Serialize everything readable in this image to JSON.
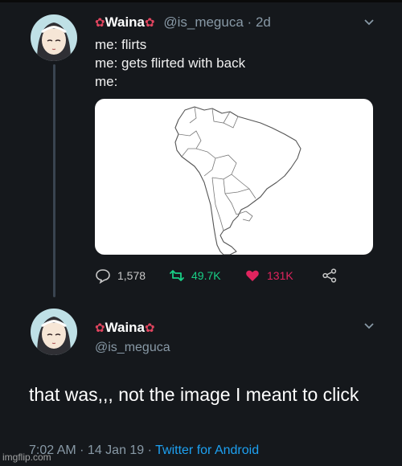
{
  "tweet1": {
    "display_name": "Waina",
    "handle": "@is_meguca",
    "time_ago": "2d",
    "lines": [
      "me: flirts",
      "me: gets flirted with back",
      "me:"
    ],
    "media_icon": "south-america-outline-map",
    "stats": {
      "replies": "1,578",
      "retweets": "49.7K",
      "likes": "131K"
    }
  },
  "tweet2": {
    "display_name": "Waina",
    "handle": "@is_meguca",
    "text": "that was,,, not the image I meant to click",
    "timestamp": "7:02 AM · 14 Jan 19 · ",
    "client": "Twitter for Android"
  },
  "watermark": "imgflip.com",
  "colors": {
    "background": "#15181c",
    "secondary_text": "#8899a6",
    "link": "#1da1f2",
    "retweet": "#19cf86",
    "like": "#e0245e",
    "flower": "#e0455f"
  }
}
